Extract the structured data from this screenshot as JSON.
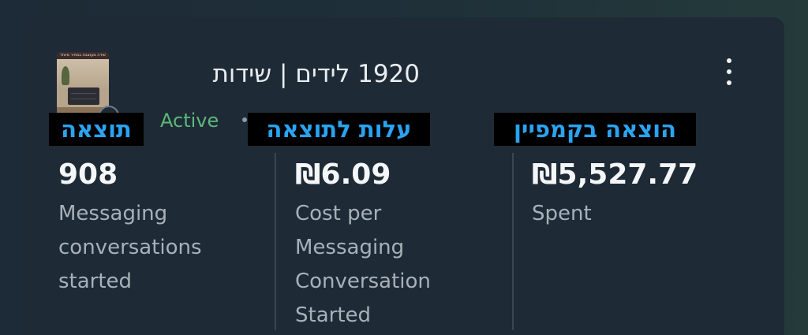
{
  "campaign": {
    "title": "1920 לידים | שידות",
    "status": "Active",
    "status_color": "#5cb87a",
    "thumbnail_caption": "שידה מעוצבת במחיר מיוחד"
  },
  "metrics": [
    {
      "value": "908",
      "label_lines": [
        "Messaging",
        "conversations",
        "started"
      ]
    },
    {
      "value": "₪6.09",
      "label_lines": [
        "Cost per",
        "Messaging",
        "Conversation",
        "Started"
      ]
    },
    {
      "value": "₪5,527.77",
      "label_lines": [
        "Spent"
      ]
    }
  ],
  "annotations": {
    "result": "תוצאה",
    "cost_per_result": "עלות לתוצאה",
    "campaign_spend": "הוצאה בקמפיין",
    "color": "#2aa3f0"
  },
  "icons": {
    "menu": "more-vertical-icon"
  }
}
